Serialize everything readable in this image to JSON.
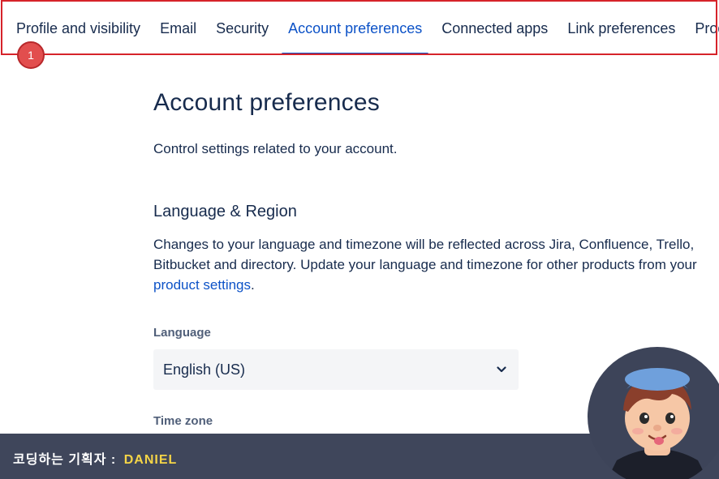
{
  "tabs": [
    {
      "label": "Profile and visibility",
      "active": false
    },
    {
      "label": "Email",
      "active": false
    },
    {
      "label": "Security",
      "active": false
    },
    {
      "label": "Account preferences",
      "active": true
    },
    {
      "label": "Connected apps",
      "active": false
    },
    {
      "label": "Link preferences",
      "active": false
    },
    {
      "label": "Products",
      "active": false
    }
  ],
  "annotation": {
    "step_number": "1",
    "highlight_color": "#d6232a"
  },
  "main": {
    "title": "Account preferences",
    "description": "Control settings related to your account.",
    "section": {
      "title": "Language & Region",
      "desc_line1": "Changes to your language and timezone will be reflected across Jira, Confluence, Trello,",
      "desc_line2": "Bitbucket and directory. Update your language and timezone for other products from your",
      "link_text": "product settings",
      "link_suffix": "."
    },
    "language": {
      "label": "Language",
      "value": "English (US)"
    },
    "timezone": {
      "label": "Time zone",
      "value": ""
    }
  },
  "banner": {
    "prefix": "코딩하는 기획자 : ",
    "name": "DANIEL"
  },
  "colors": {
    "accent": "#0c52c7",
    "text": "#172b4d",
    "banner": "#3f465b",
    "banner_name": "#f5d547"
  },
  "icons": {
    "select_chevron": "chevron-down-icon",
    "avatar": "avatar-illustration"
  }
}
